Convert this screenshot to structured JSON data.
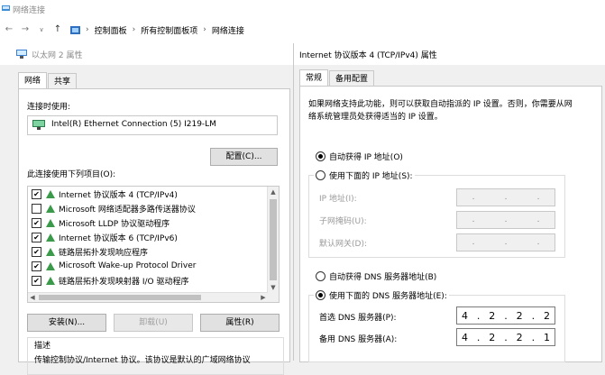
{
  "explorer": {
    "title": "网络连接",
    "breadcrumb": [
      "控制面板",
      "所有控制面板项",
      "网络连接"
    ]
  },
  "left_dialog": {
    "title": "以太网 2 属性",
    "tabs": [
      "网络",
      "共享"
    ],
    "connect_using_label": "连接时使用:",
    "adapter_name": "Intel(R) Ethernet Connection (5) I219-LM",
    "configure_button": "配置(C)...",
    "items_label": "此连接使用下列项目(O):",
    "items": [
      {
        "label": "Internet 协议版本 4 (TCP/IPv4)",
        "checked": true
      },
      {
        "label": "Microsoft 网络适配器多路传送器协议",
        "checked": false
      },
      {
        "label": "Microsoft LLDP 协议驱动程序",
        "checked": true
      },
      {
        "label": "Internet 协议版本 6 (TCP/IPv6)",
        "checked": true
      },
      {
        "label": "链路层拓扑发现响应程序",
        "checked": true
      },
      {
        "label": "Microsoft Wake-up Protocol Driver",
        "checked": true
      },
      {
        "label": "链路层拓扑发现映射器 I/O 驱动程序",
        "checked": true
      }
    ],
    "install_button": "安装(N)...",
    "uninstall_button": "卸载(U)",
    "properties_button": "属性(R)",
    "description_label": "描述",
    "description_text": "传输控制协议/Internet 协议。该协议是默认的广域网络协议"
  },
  "right_dialog": {
    "title": "Internet 协议版本 4 (TCP/IPv4) 属性",
    "tabs": [
      "常规",
      "备用配置"
    ],
    "intro": [
      "如果网络支持此功能，则可以获取自动指派的 IP 设置。否则，你需要从网",
      "络系统管理员处获得适当的 IP 设置。"
    ],
    "ip_auto": "自动获得 IP 地址(O)",
    "ip_manual": "使用下面的 IP 地址(S):",
    "ip_address_label": "IP 地址(I):",
    "subnet_label": "子网掩码(U):",
    "gateway_label": "默认网关(D):",
    "dns_auto": "自动获得 DNS 服务器地址(B)",
    "dns_manual": "使用下面的 DNS 服务器地址(E):",
    "preferred_dns_label": "首选 DNS 服务器(P):",
    "alternate_dns_label": "备用 DNS 服务器(A):",
    "preferred_dns": [
      "4",
      "2",
      "2",
      "2"
    ],
    "alternate_dns": [
      "4",
      "2",
      "2",
      "1"
    ],
    "ip_selected": "auto",
    "dns_selected": "manual"
  }
}
